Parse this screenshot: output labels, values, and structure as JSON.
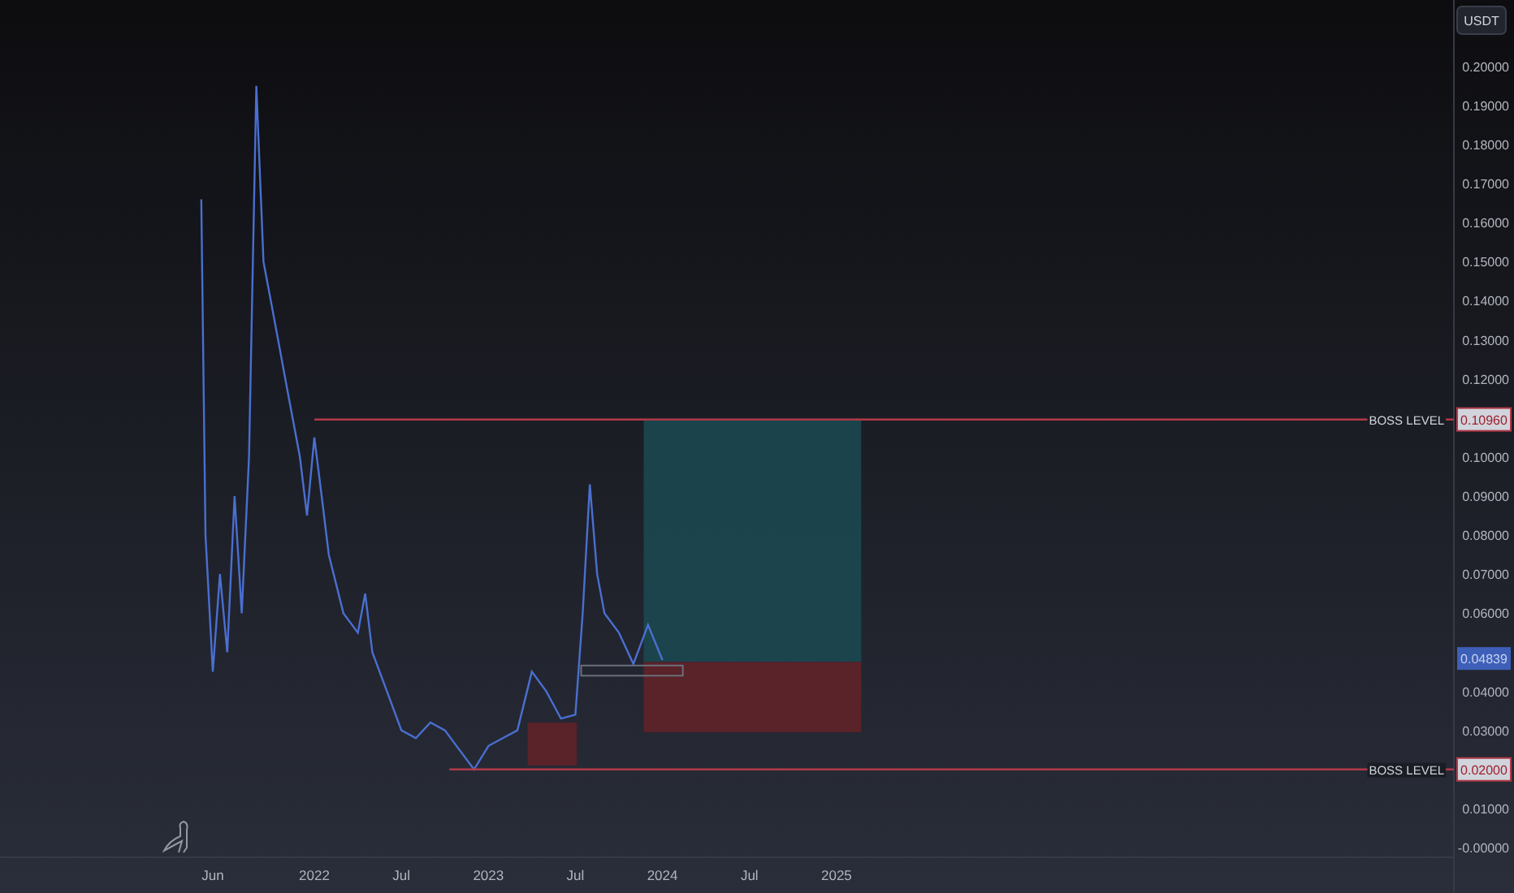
{
  "currency_button": {
    "label": "USDT"
  },
  "chart_data": {
    "type": "line",
    "x": [
      2021.35,
      2021.375,
      2021.417,
      2021.458,
      2021.5,
      2021.542,
      2021.583,
      2021.625,
      2021.667,
      2021.708,
      2021.75,
      2021.792,
      2021.833,
      2021.917,
      2021.958,
      2022.0,
      2022.042,
      2022.083,
      2022.167,
      2022.25,
      2022.292,
      2022.333,
      2022.417,
      2022.5,
      2022.583,
      2022.667,
      2022.75,
      2022.833,
      2022.917,
      2023.0,
      2023.083,
      2023.167,
      2023.25,
      2023.333,
      2023.417,
      2023.5,
      2023.542,
      2023.583,
      2023.625,
      2023.667,
      2023.75,
      2023.833,
      2023.917,
      2024.0
    ],
    "series": [
      {
        "color": "#4a6fd0",
        "values": [
          0.166,
          0.08,
          0.045,
          0.07,
          0.05,
          0.09,
          0.06,
          0.1,
          0.195,
          0.15,
          0.14,
          0.13,
          0.12,
          0.1,
          0.085,
          0.105,
          0.09,
          0.075,
          0.06,
          0.055,
          0.065,
          0.05,
          0.04,
          0.03,
          0.028,
          0.032,
          0.03,
          0.025,
          0.02,
          0.026,
          0.028,
          0.03,
          0.045,
          0.04,
          0.033,
          0.034,
          0.06,
          0.093,
          0.07,
          0.06,
          0.055,
          0.047,
          0.057,
          0.048
        ]
      }
    ],
    "xlim": [
      2020.194,
      2028.547
    ],
    "ylim": [
      -0.0025,
      0.217
    ],
    "xticks": [
      {
        "value": 2021.417,
        "label": "Jun"
      },
      {
        "value": 2022,
        "label": "2022"
      },
      {
        "value": 2022.5,
        "label": "Jul"
      },
      {
        "value": 2023,
        "label": "2023"
      },
      {
        "value": 2023.5,
        "label": "Jul"
      },
      {
        "value": 2024,
        "label": "2024"
      },
      {
        "value": 2024.5,
        "label": "Jul"
      },
      {
        "value": 2025,
        "label": "2025"
      }
    ],
    "yticks": [
      {
        "value": 0.2,
        "label": "0.20000"
      },
      {
        "value": 0.19,
        "label": "0.19000"
      },
      {
        "value": 0.18,
        "label": "0.18000"
      },
      {
        "value": 0.17,
        "label": "0.17000"
      },
      {
        "value": 0.16,
        "label": "0.16000"
      },
      {
        "value": 0.15,
        "label": "0.15000"
      },
      {
        "value": 0.14,
        "label": "0.14000"
      },
      {
        "value": 0.13,
        "label": "0.13000"
      },
      {
        "value": 0.12,
        "label": "0.12000"
      },
      {
        "value": 0.1,
        "label": "0.10000"
      },
      {
        "value": 0.09,
        "label": "0.09000"
      },
      {
        "value": 0.08,
        "label": "0.08000"
      },
      {
        "value": 0.07,
        "label": "0.07000"
      },
      {
        "value": 0.06,
        "label": "0.06000"
      },
      {
        "value": 0.04,
        "label": "0.04000"
      },
      {
        "value": 0.03,
        "label": "0.03000"
      },
      {
        "value": 0.01,
        "label": "0.01000"
      },
      {
        "value": 0,
        "label": "-0.00000"
      }
    ]
  },
  "drawings": [
    {
      "kind": "hline",
      "label": "BOSS LEVEL",
      "price_label": "0.10960"
    },
    {
      "kind": "long_position"
    },
    {
      "kind": "price_tag",
      "label": "0.04839"
    },
    {
      "kind": "outline_rectangle"
    },
    {
      "kind": "rectangle"
    },
    {
      "kind": "hline",
      "label": "BOSS LEVEL",
      "price_label": "0.02000"
    }
  ]
}
